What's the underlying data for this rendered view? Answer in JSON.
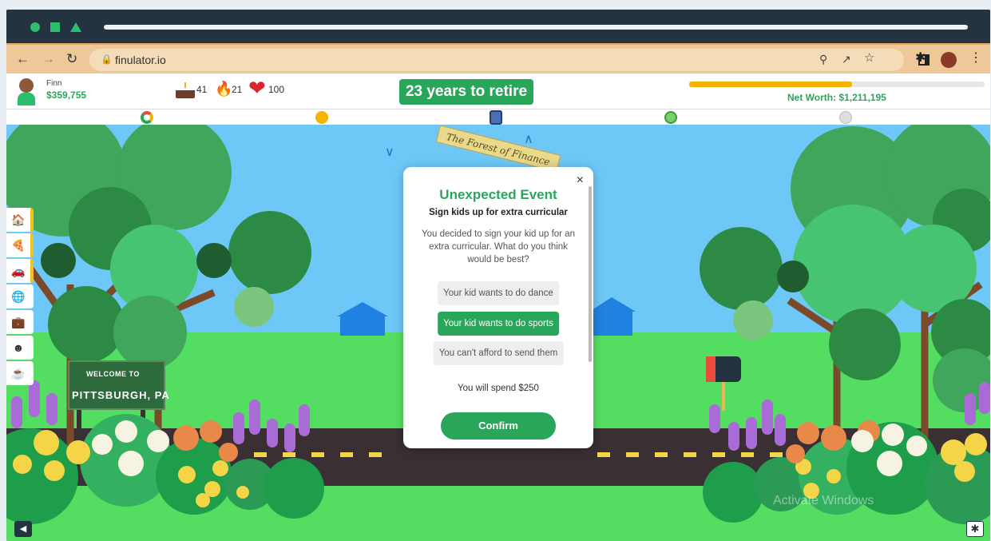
{
  "browser": {
    "url": "finulator.io"
  },
  "player": {
    "name": "Finn",
    "cash": "$359,755"
  },
  "stats": {
    "age": "41",
    "streak": "21",
    "health": "100"
  },
  "retire_banner": "23 years to retire",
  "net_worth": {
    "label": "Net Worth: $1,211,195",
    "progress": 0.55
  },
  "location_banner": "The Forest of Finance",
  "sign": {
    "line1": "WELCOME TO",
    "line2": "PITTSBURGH, PA"
  },
  "modal": {
    "title": "Unexpected Event",
    "subtitle": "Sign kids up for extra curricular",
    "body": "You decided to sign your kid up for an extra curricular. What do you think would be best?",
    "options": [
      {
        "label": "Your kid wants to do dance",
        "selected": false
      },
      {
        "label": "Your kid wants to do sports",
        "selected": true
      },
      {
        "label": "You can't afford to send them",
        "selected": false
      }
    ],
    "spend": "You will spend $250",
    "confirm": "Confirm",
    "close": "×"
  },
  "watermark": "Activate Windows",
  "colors": {
    "accent": "#2aa65b",
    "progress": "#f4b400",
    "sidebar_accent": "#f4c21b"
  },
  "icons": [
    "back-icon",
    "forward-icon",
    "reload-icon",
    "lock-icon",
    "zoom-icon",
    "share-icon",
    "bookmark-star-icon",
    "extensions-icon",
    "sidepanel-icon",
    "profile-avatar-icon",
    "menu-icon",
    "cake-icon",
    "flame-icon",
    "heart-icon",
    "chevron-down-icon",
    "chevron-up-icon",
    "mute-icon",
    "settings-icon"
  ]
}
